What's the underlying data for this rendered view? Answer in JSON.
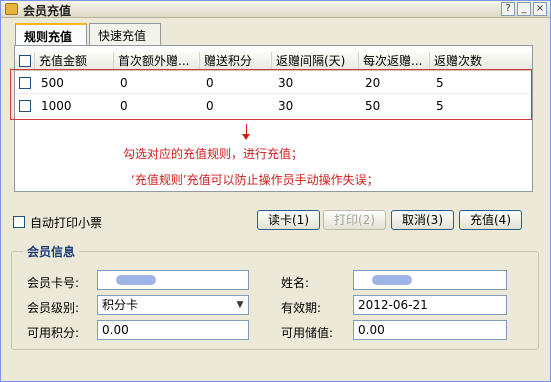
{
  "window": {
    "title": "会员充值",
    "buttons": [
      "?",
      "_",
      "×"
    ]
  },
  "tabs": [
    {
      "label": "规则充值",
      "active": true
    },
    {
      "label": "快速充值",
      "active": false
    }
  ],
  "grid": {
    "columns": [
      "充值金额",
      "首次额外赠...",
      "赠送积分",
      "返赠间隔(天)",
      "每次返赠...",
      "返赠次数"
    ],
    "rows": [
      {
        "checked": false,
        "cells": [
          "500",
          "0",
          "0",
          "30",
          "20",
          "5"
        ]
      },
      {
        "checked": false,
        "cells": [
          "1000",
          "0",
          "0",
          "30",
          "50",
          "5"
        ]
      }
    ]
  },
  "annotation": {
    "line1": "勾选对应的充值规则，进行充值；",
    "line2": "‘充值规则’充值可以防止操作员手动操作失误；",
    "color": "#d11c1c"
  },
  "auto_print": {
    "label": "自动打印小票",
    "checked": false
  },
  "actions": {
    "read_card": "读卡(1)",
    "print": "打印(2)",
    "cancel": "取消(3)",
    "recharge": "充值(4)"
  },
  "member_info": {
    "title": "会员信息",
    "card_no_label": "会员卡号:",
    "card_no_value": "",
    "name_label": "姓名:",
    "name_value": "",
    "level_label": "会员级别:",
    "level_value": "积分卡",
    "expiry_label": "有效期:",
    "expiry_value": "2012-06-21",
    "points_label": "可用积分:",
    "points_value": "0.00",
    "balance_label": "可用储值:",
    "balance_value": "0.00"
  }
}
